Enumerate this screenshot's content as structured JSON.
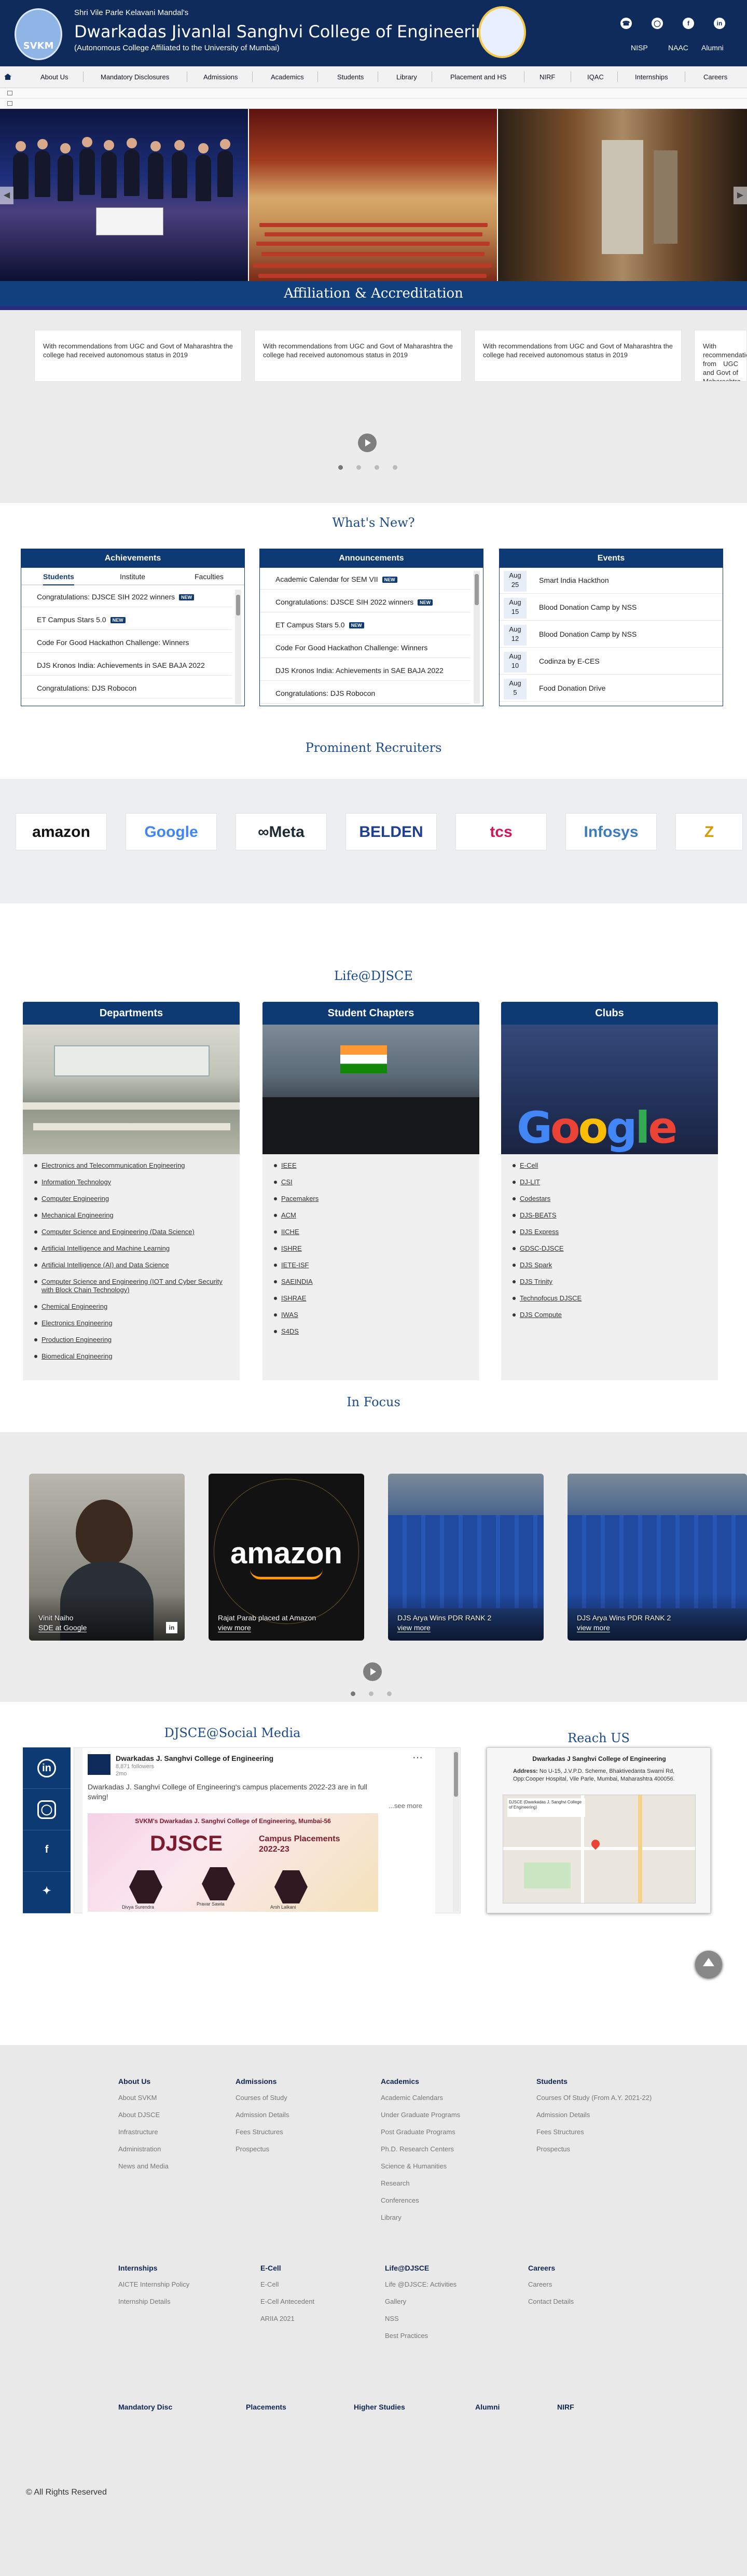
{
  "header": {
    "logo_text": "SVKM",
    "kicker": "Shri Vile Parle Kelavani Mandal's",
    "college_name": "Dwarkadas Jivanlal Sanghvi College of Engineering",
    "tagline": "(Autonomous College Affiliated to the University of Mumbai)",
    "quick_links": [
      {
        "label": "NISP",
        "icon": "phone-icon"
      },
      {
        "label": "NAAC",
        "icon": "instagram-icon"
      },
      {
        "label": "Alumni",
        "icon": "facebook-icon"
      },
      {
        "label": "",
        "icon": "linkedin-icon"
      }
    ]
  },
  "nav": {
    "items": [
      "About Us",
      "Mandatory Disclosures",
      "Admissions",
      "Academics",
      "Students",
      "Library",
      "Placement and HS",
      "NIRF",
      "IQAC",
      "Internships",
      "Careers"
    ]
  },
  "affiliation": {
    "title": "Affiliation & Accreditation",
    "card_text": "With recommendations from UGC and Govt of Maharashtra the college had received autonomous status in 2019"
  },
  "whats_new": {
    "title": "What's New?",
    "new_badge": "NEW",
    "achievements": {
      "title": "Achievements",
      "tabs": [
        "Students",
        "Institute",
        "Faculties"
      ],
      "items": [
        {
          "text": "Congratulations: DJSCE SIH 2022 winners",
          "new": true
        },
        {
          "text": "ET Campus Stars 5.0",
          "new": true
        },
        {
          "text": "Code For Good Hackathon Challenge: Winners",
          "new": false
        },
        {
          "text": "DJS Kronos India: Achievements in SAE BAJA 2022",
          "new": false
        },
        {
          "text": "Congratulations: DJS Robocon",
          "new": false
        }
      ]
    },
    "announcements": {
      "title": "Announcements",
      "items": [
        {
          "text": "Academic Calendar for SEM VII",
          "new": true
        },
        {
          "text": "Congratulations: DJSCE SIH 2022 winners",
          "new": true
        },
        {
          "text": "ET Campus Stars 5.0",
          "new": true
        },
        {
          "text": "Code For Good Hackathon Challenge: Winners",
          "new": false
        },
        {
          "text": "DJS Kronos India: Achievements in SAE BAJA 2022",
          "new": false
        },
        {
          "text": "Congratulations: DJS Robocon",
          "new": false
        }
      ]
    },
    "events": {
      "title": "Events",
      "items": [
        {
          "month": "Aug",
          "day": "25",
          "title": "Smart India Hackthon"
        },
        {
          "month": "Aug",
          "day": "15",
          "title": "Blood Donation Camp by NSS"
        },
        {
          "month": "Aug",
          "day": "12",
          "title": "Blood Donation Camp by NSS"
        },
        {
          "month": "Aug",
          "day": "10",
          "title": "Codinza by E-CES"
        },
        {
          "month": "Aug",
          "day": "5",
          "title": "Food Donation Drive"
        }
      ]
    }
  },
  "recruiters": {
    "title": "Prominent Recruiters",
    "brands": [
      {
        "name": "amazon",
        "color": "#111111"
      },
      {
        "name": "Google",
        "color": "#4285f4"
      },
      {
        "name": "∞Meta",
        "color": "#1c2b33"
      },
      {
        "name": "BELDEN",
        "color": "#1f3f8f"
      },
      {
        "name": "tcs",
        "color": "#d4145a"
      },
      {
        "name": "Infosys",
        "color": "#3b7bbf"
      },
      {
        "name": "Z",
        "color": "#d69b00"
      }
    ]
  },
  "life": {
    "title": "Life@DJSCE",
    "departments": {
      "title": "Departments",
      "items": [
        "Electronics and Telecommunication Engineering",
        "Information Technology",
        "Computer Engineering",
        "Mechanical Engineering",
        "Computer Science and Engineering (Data Science)",
        "Artificial Intelligence and Machine Learning",
        "Artificial Intelligence (AI) and Data Science",
        "Computer Science and Engineering (IOT and Cyber Security with Block Chain Technology)",
        "Chemical Engineering",
        "Electronics Engineering",
        "Production Engineering",
        "Biomedical Engineering"
      ]
    },
    "chapters": {
      "title": "Student Chapters",
      "items": [
        "IEEE",
        "CSI",
        "Pacemakers",
        "ACM",
        "IICHE",
        "ISHRE",
        "IETE-ISF",
        "SAEINDIA",
        "ISHRAE",
        "IWAS",
        "S4DS"
      ]
    },
    "clubs": {
      "title": "Clubs",
      "items": [
        "E-Cell",
        "DJ-LIT",
        "Codestars",
        "DJS-BEATS",
        "DJS Express",
        "GDSC-DJSCE",
        "DJS Spark",
        "DJS Trinity",
        "Technofocus DJSCE",
        "DJS Compute"
      ]
    }
  },
  "focus": {
    "title": "In Focus",
    "cards": [
      {
        "name": "Vinit Naiho",
        "sub": "SDE at Google"
      },
      {
        "name": "Rajat Parab placed at Amazon",
        "sub": "view more"
      },
      {
        "name": "DJS Arya Wins PDR RANK 2",
        "sub": "view more"
      },
      {
        "name": "DJS Arya Wins PDR RANK 2",
        "sub": "view more"
      }
    ]
  },
  "social": {
    "title": "DJSCE@Social Media",
    "post": {
      "org": "Dwarkadas J. Sanghvi College of Engineering",
      "meta": "8,871 followers",
      "age": "2mo",
      "text": "Dwarkadas J. Sanghvi College of Engineering's campus placements 2022-23 are in full swing!",
      "see_more": "...see more",
      "banner_top": "SVKM's Dwarkadas J. Sanghvi College of Engineering, Mumbai-56",
      "banner_big": "DJSCE",
      "banner_sub": "Campus Placements 2022-23",
      "people": [
        "Divya Surendra",
        "Pravar Sawla",
        "Arsh Lalkani"
      ]
    }
  },
  "reach": {
    "title": "Reach US",
    "map_title": "Dwarkadas J Sanghvi College of Engineering",
    "address_label": "Address:",
    "address": "No U-15, J.V.P.D. Scheme, Bhaktivedanta Swami Rd, Opp:Cooper Hospital, Vile Parle, Mumbai, Maharashtra 400056.",
    "map_place": "DJSCE (Dwarkadas J. Sanghvi College of Engineering)"
  },
  "footer": {
    "cols": [
      {
        "title": "About Us",
        "links": [
          "About SVKM",
          "About DJSCE",
          "Infrastructure",
          "Administration",
          "News and Media"
        ]
      },
      {
        "title": "Admissions",
        "links": [
          "Courses of Study",
          "Admission Details",
          "Fees Structures",
          "Prospectus"
        ]
      },
      {
        "title": "Academics",
        "links": [
          "Academic Calendars",
          "Under Graduate Programs",
          "Post Graduate Programs",
          "Ph.D. Research Centers",
          "Science & Humanities",
          "Research",
          "Conferences",
          "Library"
        ]
      },
      {
        "title": "Students",
        "links": [
          "Courses Of Study (From A.Y. 2021-22)",
          "Admission Details",
          "Fees Structures",
          "Prospectus"
        ]
      },
      {
        "title": "Internships",
        "links": [
          "AICTE Internship Policy",
          "Internship Details"
        ]
      },
      {
        "title": "E-Cell",
        "links": [
          "E-Cell",
          "E-Cell Antecedent",
          "ARIIA 2021"
        ]
      },
      {
        "title": "Life@DJSCE",
        "links": [
          "Life @DJSCE: Activities",
          "Gallery",
          "NSS",
          "Best Practices"
        ]
      },
      {
        "title": "Careers",
        "links": [
          "Careers",
          "Contact Details"
        ]
      }
    ],
    "bottom_links": [
      "Mandatory Disc",
      "Placements",
      "Higher Studies",
      "Alumni",
      "NIRF"
    ],
    "copyright": "© All Rights Reserved"
  }
}
